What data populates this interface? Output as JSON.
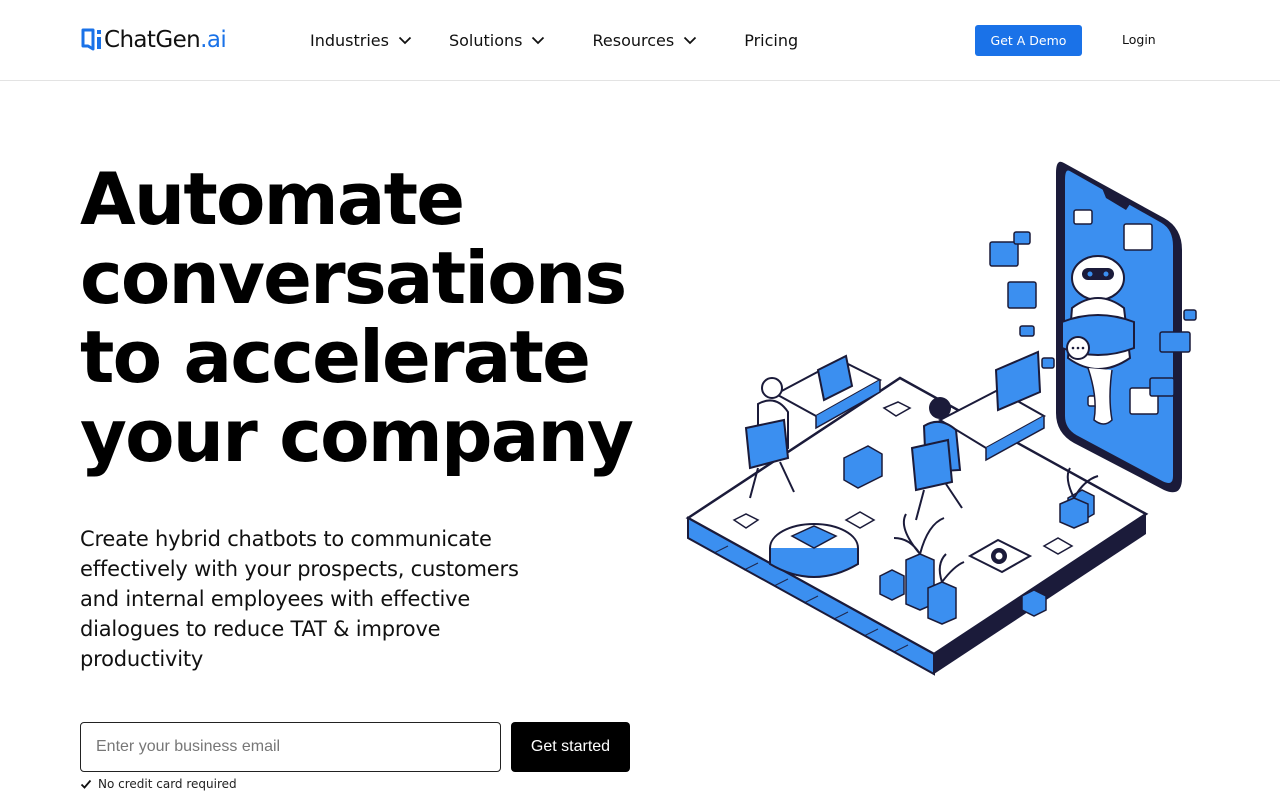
{
  "brand": {
    "name_part1": "ChatGen",
    "name_part2": ".ai",
    "color": "#1a72e8",
    "icon": "chat-bubble-logo-icon"
  },
  "nav": {
    "industries": "Industries",
    "solutions": "Solutions",
    "resources": "Resources",
    "pricing": "Pricing",
    "dropdown_icon": "chevron-down-icon"
  },
  "header_actions": {
    "demo": "Get A Demo",
    "login": "Login"
  },
  "hero": {
    "headline": "Automate conversations to accelerate your company",
    "subtext": "Create hybrid chatbots to communicate effectively with your prospects, customers and internal employees with effective dialogues to reduce TAT & improve productivity",
    "email_placeholder": "Enter your business email",
    "cta": "Get started",
    "note": "No credit card required",
    "note_icon": "checkmark-icon",
    "illustration": "isometric-office-chatbot-illustration"
  },
  "colors": {
    "accent": "#1a72e8",
    "text": "#000000",
    "cta_bg": "#000000",
    "illustration_blue": "#3b8ff0",
    "illustration_dark": "#1b1b3a"
  }
}
